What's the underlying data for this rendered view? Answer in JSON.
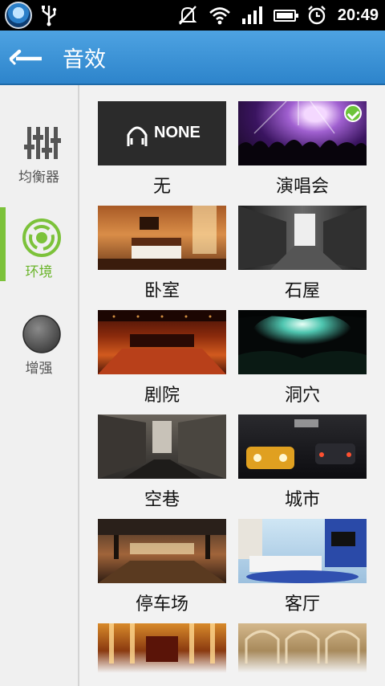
{
  "status_bar": {
    "time": "20:49",
    "icons": [
      "app-badge-icon",
      "usb-icon",
      "mute-icon",
      "wifi-icon",
      "signal-icon",
      "battery-icon",
      "alarm-icon"
    ]
  },
  "header": {
    "title": "音效",
    "back_icon": "back-arrow-icon"
  },
  "sidebar": {
    "items": [
      {
        "label": "均衡器",
        "icon": "equalizer-icon",
        "active": false
      },
      {
        "label": "环境",
        "icon": "surround-icon",
        "active": true
      },
      {
        "label": "增强",
        "icon": "knob-icon",
        "active": false
      }
    ]
  },
  "effects": {
    "none_text": "NONE",
    "items": [
      {
        "label": "无",
        "selected": false
      },
      {
        "label": "演唱会",
        "selected": true
      },
      {
        "label": "卧室",
        "selected": false
      },
      {
        "label": "石屋",
        "selected": false
      },
      {
        "label": "剧院",
        "selected": false
      },
      {
        "label": "洞穴",
        "selected": false
      },
      {
        "label": "空巷",
        "selected": false
      },
      {
        "label": "城市",
        "selected": false
      },
      {
        "label": "停车场",
        "selected": false
      },
      {
        "label": "客厅",
        "selected": false
      },
      {
        "label": "",
        "selected": false
      },
      {
        "label": "",
        "selected": false
      }
    ]
  },
  "colors": {
    "accent_green": "#7cc23a",
    "header_blue": "#3a92d6"
  }
}
